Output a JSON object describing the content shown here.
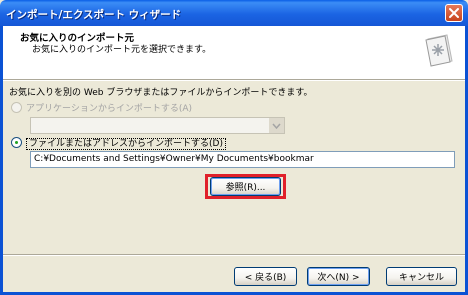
{
  "window": {
    "title": "インポート/エクスポート ウィザード"
  },
  "header": {
    "title": "お気に入りのインポート元",
    "subtitle": "お気に入りのインポート元を選択できます。"
  },
  "body": {
    "description": "お気に入りを別の Web ブラウザまたはファイルからインポートできます。",
    "option_app": {
      "label": "アプリケーションからインポートする(A)",
      "selected": false,
      "enabled": false,
      "combo_value": ""
    },
    "option_file": {
      "label": "ファイルまたはアドレスからインポートする(D)",
      "selected": true,
      "enabled": true,
      "path_value": "C:¥Documents and Settings¥Owner¥My Documents¥bookmar"
    },
    "browse_label": "参照(R)..."
  },
  "footer": {
    "back_label": "< 戻る(B)",
    "next_label": "次へ(N) >",
    "cancel_label": "キャンセル"
  },
  "colors": {
    "titlebar": "#1b64e3",
    "highlight": "#e0202a",
    "window_bg": "#ece9d8"
  },
  "icons": [
    "close-icon",
    "wizard-graphic-icon",
    "dropdown-arrow-icon"
  ]
}
